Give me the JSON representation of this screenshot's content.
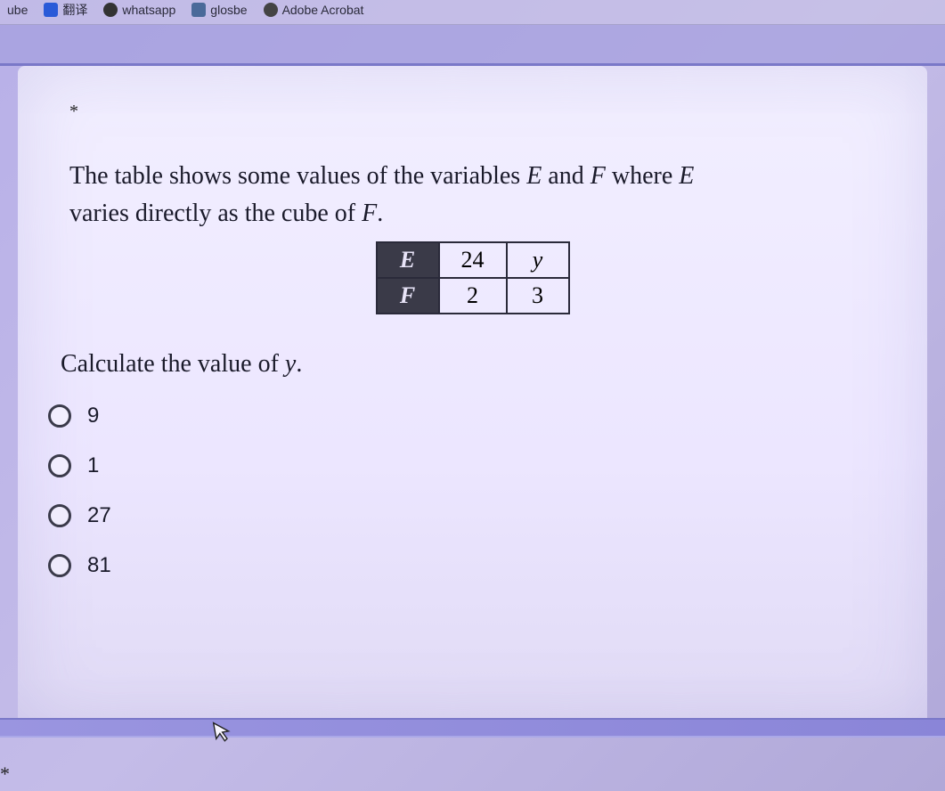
{
  "bookmarks": {
    "items": [
      {
        "label": "ube"
      },
      {
        "label": "翻译"
      },
      {
        "label": "whatsapp"
      },
      {
        "label": "glosbe"
      },
      {
        "label": "Adobe Acrobat"
      }
    ]
  },
  "question": {
    "required_marker": "*",
    "prompt_part1": "The table shows some values of the variables ",
    "var_E": "E",
    "prompt_and": " and ",
    "var_F": "F",
    "prompt_where": " where ",
    "prompt_part2": " varies directly as the cube of ",
    "prompt_end": ".",
    "table": {
      "row1_header": "E",
      "row1_c1": "24",
      "row1_c2": "y",
      "row2_header": "F",
      "row2_c1": "2",
      "row2_c2": "3"
    },
    "sub_prompt_a": "Calculate the value of ",
    "sub_var": "y",
    "sub_prompt_b": ".",
    "options": [
      "9",
      "1",
      "27",
      "81"
    ]
  },
  "footer_asterisk": "*"
}
